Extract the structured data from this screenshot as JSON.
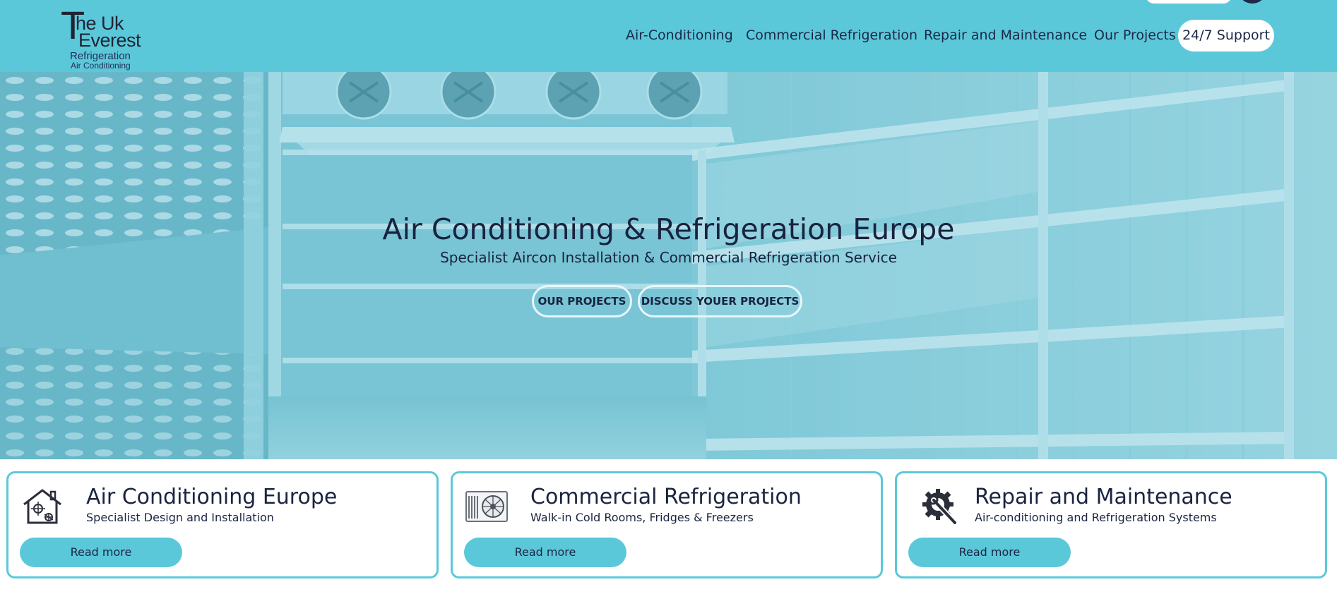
{
  "header": {
    "logo": {
      "line1_letter": "T",
      "line1_rest": "he Uk",
      "line2": "Everest",
      "line3": "Refrigeration",
      "line4": "Air Conditioning"
    },
    "nav": [
      {
        "label": "Air-Conditioning"
      },
      {
        "label": "Commercial Refrigeration"
      },
      {
        "label": "Repair and Maintenance"
      },
      {
        "label": "Our Projects"
      }
    ],
    "support_label": "24/7 Support"
  },
  "hero": {
    "title": "Air Conditioning & Refrigeration Europe",
    "subtitle": "Specialist Aircon Installation & Commercial Refrigeration Service",
    "buttons": [
      {
        "label": "OUR PROJECTS"
      },
      {
        "label": "DISCUSS YOUER PROJECTS"
      }
    ]
  },
  "cards": [
    {
      "icon": "smart-home-climate-icon",
      "title": "Air Conditioning Europe",
      "subtitle": "Specialist Design and Installation",
      "button": "Read more"
    },
    {
      "icon": "air-conditioner-unit-icon",
      "title": "Commercial Refrigeration",
      "subtitle": "Walk-in Cold Rooms, Fridges & Freezers",
      "button": "Read more"
    },
    {
      "icon": "gear-wrench-icon",
      "title": "Repair and Maintenance",
      "subtitle": "Air-conditioning and Refrigeration Systems",
      "button": "Read more"
    }
  ],
  "colors": {
    "accent": "#5bc8da",
    "text_dark": "#1b2440",
    "hero_tint": "#72c1d0"
  }
}
